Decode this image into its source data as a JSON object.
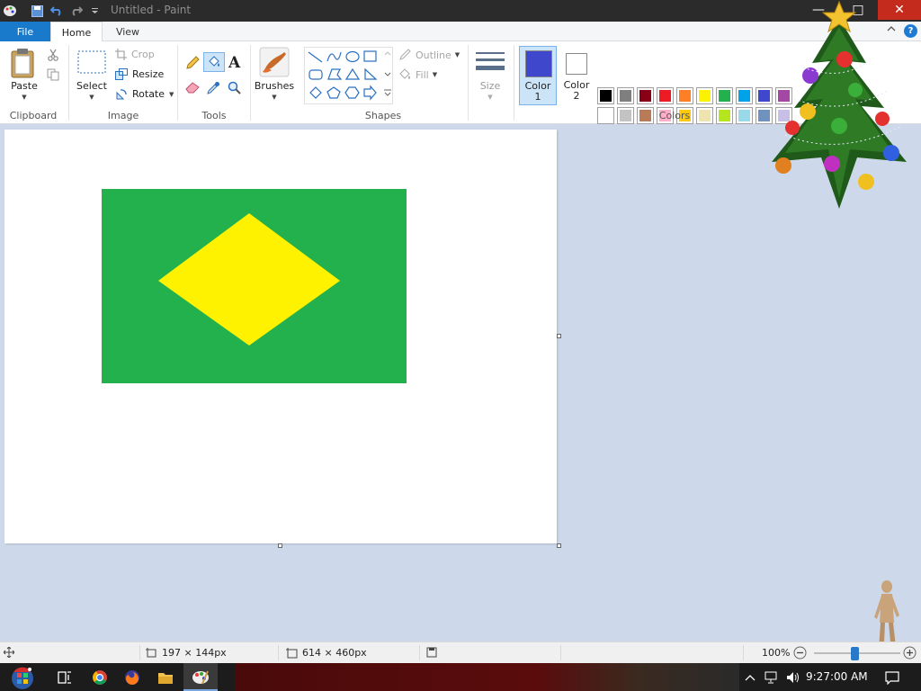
{
  "window": {
    "title": "Untitled - Paint",
    "minimize_glyph": "—",
    "maximize_glyph": "□",
    "close_glyph": "✕"
  },
  "tabs": {
    "file": "File",
    "home": "Home",
    "view": "View",
    "help": "?"
  },
  "ribbon": {
    "clipboard": {
      "label": "Clipboard",
      "paste": "Paste"
    },
    "image": {
      "label": "Image",
      "select": "Select",
      "crop": "Crop",
      "resize": "Resize",
      "rotate": "Rotate"
    },
    "tools": {
      "label": "Tools"
    },
    "brushes": {
      "label": "Brushes"
    },
    "shapes": {
      "label": "Shapes",
      "outline": "Outline",
      "fill": "Fill"
    },
    "size": {
      "label": "Size"
    },
    "colors": {
      "label": "Colors",
      "color1": "Color 1",
      "color1_line1": "Color",
      "color1_line2": "1",
      "color2_line1": "Color",
      "color2_line2": "2",
      "color1_value": "#3f48cc",
      "color2_value": "#ffffff",
      "palette_row1": [
        "#000000",
        "#7f7f7f",
        "#880015",
        "#ed1c24",
        "#ff7f27",
        "#fff200",
        "#22b14c",
        "#00a2e8",
        "#3f48cc",
        "#a349a4"
      ],
      "palette_row2": [
        "#ffffff",
        "#c3c3c3",
        "#b97a57",
        "#ffaec9",
        "#ffc90e",
        "#efe4b0",
        "#b5e61d",
        "#99d9ea",
        "#7092be",
        "#c8bfe7"
      ]
    }
  },
  "canvas": {
    "flag_green": "#22b14c",
    "flag_yellow": "#fff200"
  },
  "status": {
    "cursor_pos": "197 × 144px",
    "canvas_size": "614 × 460px",
    "zoom": "100%"
  },
  "taskbar": {
    "time": "9:27:00 AM"
  }
}
